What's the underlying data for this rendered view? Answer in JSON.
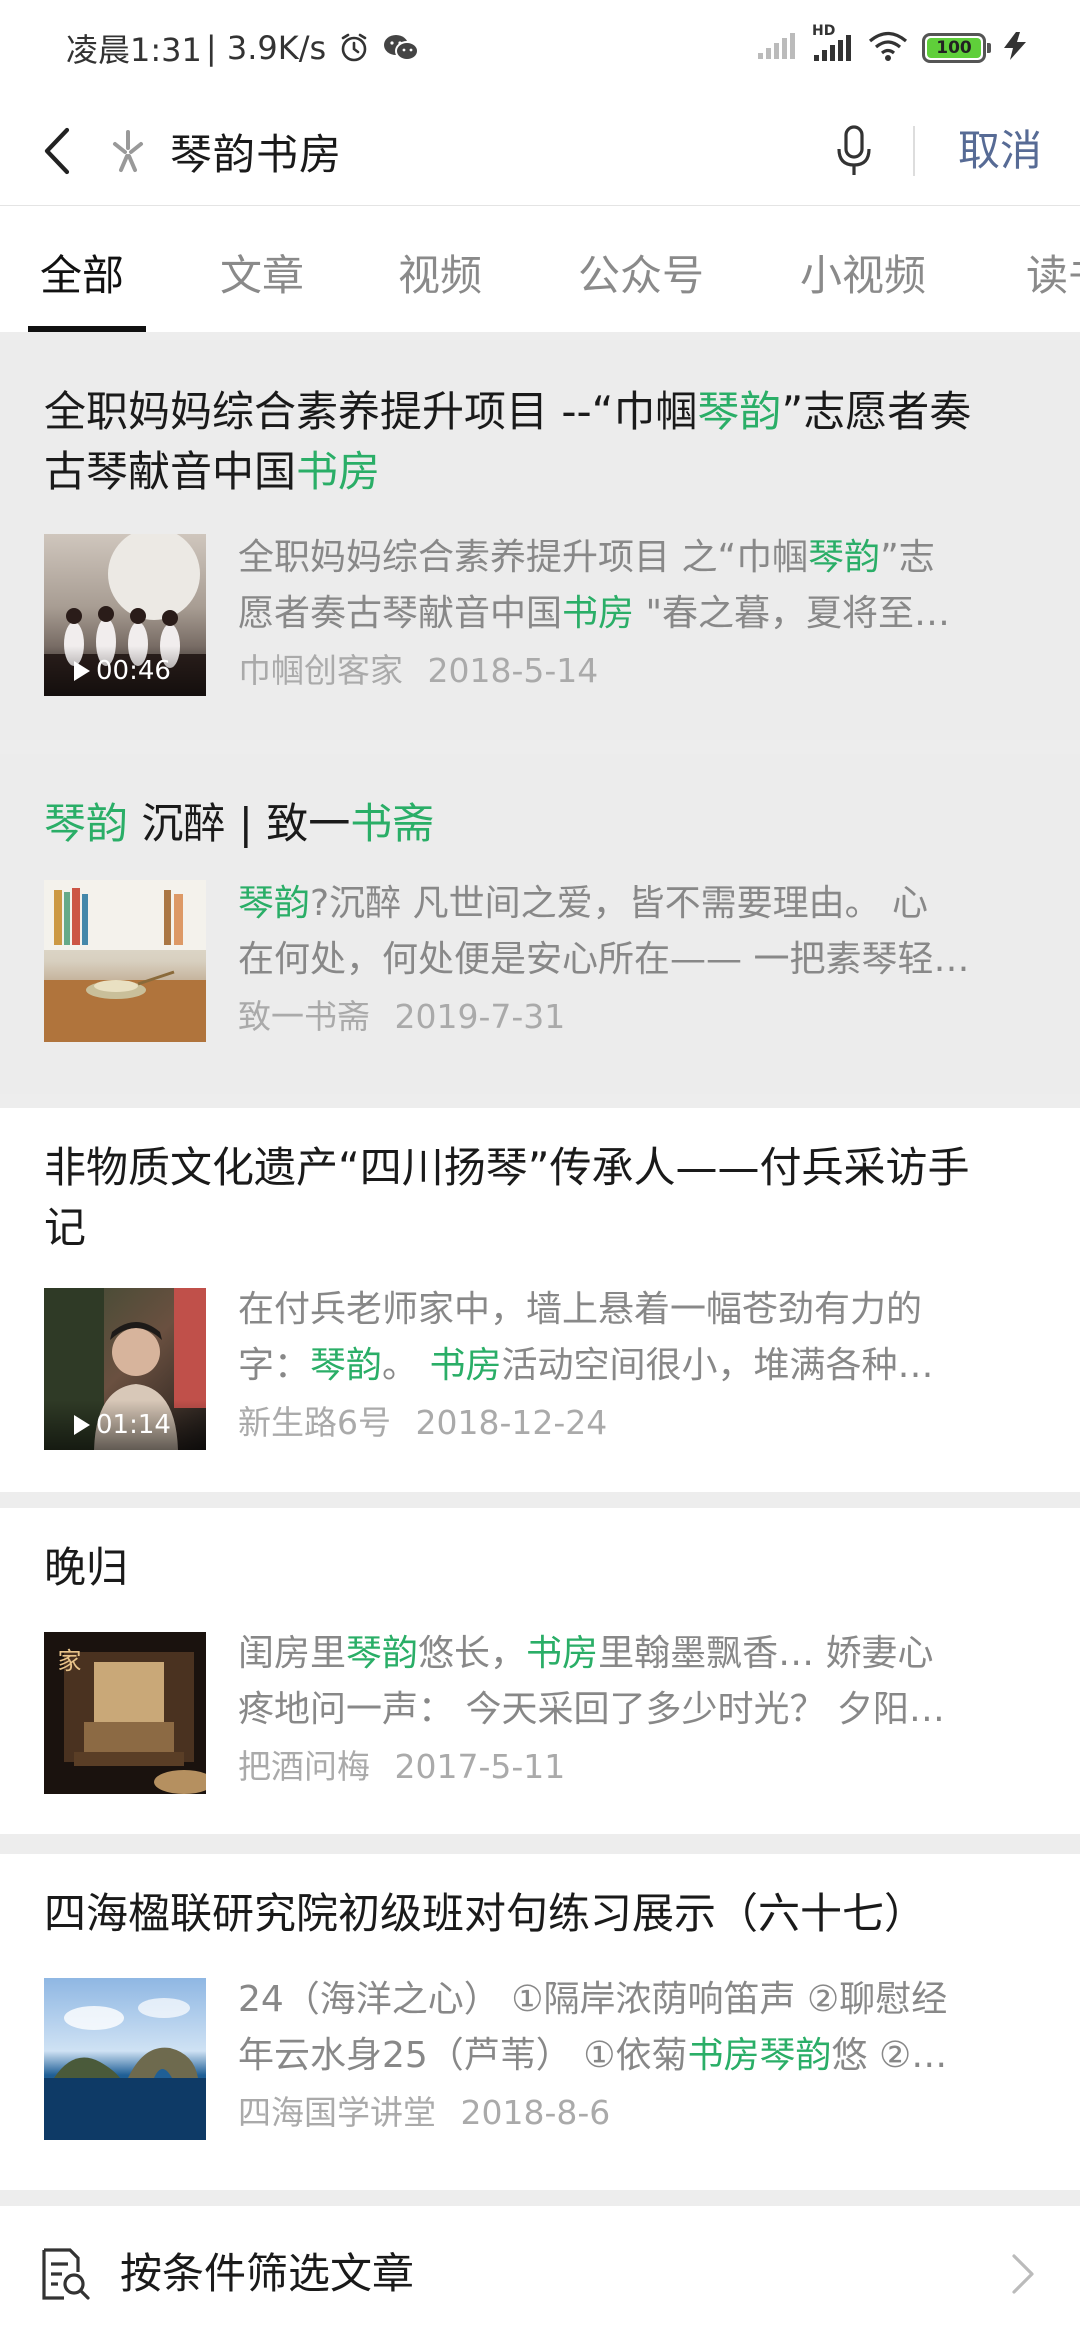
{
  "status_bar": {
    "time": "凌晨1:31",
    "speed": "| 3.9K/s",
    "network": "HD",
    "battery": "100"
  },
  "search": {
    "query": "琴韵书房",
    "cancel_label": "取消"
  },
  "tabs": [
    "全部",
    "文章",
    "视频",
    "公众号",
    "小视频",
    "读书"
  ],
  "results": [
    {
      "title_segments": [
        [
          "全职妈妈综合素养提升项目 --“巾帼",
          false
        ],
        [
          "琴韵",
          true
        ],
        [
          "”志愿者奏",
          false
        ]
      ],
      "title_line2_segments": [
        [
          "古琴献音中国",
          false
        ],
        [
          "书房",
          true
        ]
      ],
      "desc_line1": [
        [
          "全职妈妈综合素养提升项目 之“巾帼",
          false
        ],
        [
          "琴韵",
          true
        ],
        [
          "”志",
          false
        ]
      ],
      "desc_line2": [
        [
          "愿者奏古琴献音中国",
          false
        ],
        [
          "书房",
          true
        ],
        [
          " \"春之暮，夏将至…",
          false
        ]
      ],
      "source": "巾帼创客家",
      "date": "2018-5-14",
      "duration": "00:46"
    },
    {
      "title_segments": [
        [
          "琴韵",
          true
        ],
        [
          " 沉醉 | 致一",
          false
        ],
        [
          "书斋",
          true
        ]
      ],
      "desc_line1": [
        [
          "琴韵",
          true
        ],
        [
          "?沉醉 凡世间之爱，皆不需要理由。 心",
          false
        ]
      ],
      "desc_line2": [
        [
          "在何处，何处便是安心所在—— 一把素琴轻…",
          false
        ]
      ],
      "source": "致一书斋",
      "date": "2019-7-31"
    },
    {
      "title_segments": [
        [
          "非物质文化遗产“四川扬琴”传承人——付兵采访手",
          false
        ]
      ],
      "title_line2_segments": [
        [
          "记",
          false
        ]
      ],
      "desc_line1": [
        [
          "在付兵老师家中，墙上悬着一幅苍劲有力的",
          false
        ]
      ],
      "desc_line2": [
        [
          "字：",
          false
        ],
        [
          "琴韵",
          true
        ],
        [
          "。 ",
          false
        ],
        [
          "书房",
          true
        ],
        [
          "活动空间很小，堆满各种…",
          false
        ]
      ],
      "source": "新生路6号",
      "date": "2018-12-24",
      "duration": "01:14"
    },
    {
      "title_segments": [
        [
          "晚归",
          false
        ]
      ],
      "desc_line1": [
        [
          "闺房里",
          false
        ],
        [
          "琴韵",
          true
        ],
        [
          "悠长，",
          false
        ],
        [
          "书房",
          true
        ],
        [
          "里翰墨飘香… 娇妻心",
          false
        ]
      ],
      "desc_line2": [
        [
          "疼地问一声： 今天采回了多少时光？ 夕阳…",
          false
        ]
      ],
      "source": "把酒问梅",
      "date": "2017-5-11",
      "thumb_text": "家"
    },
    {
      "title_segments": [
        [
          "四海楹联研究院初级班对句练习展示（六十七）",
          false
        ]
      ],
      "desc_line1": [
        [
          "24（海洋之心） ①隔岸浓荫响笛声 ②聊慰经",
          false
        ]
      ],
      "desc_line2": [
        [
          "年云水身25（芦苇） ①依菊",
          false
        ],
        [
          "书房琴韵",
          true
        ],
        [
          "悠 ②…",
          false
        ]
      ],
      "source": "四海国学讲堂",
      "date": "2018-8-6"
    }
  ],
  "filter": {
    "label": "按条件筛选文章"
  },
  "colors": {
    "highlight": "#2aae67",
    "link": "#576b95"
  }
}
